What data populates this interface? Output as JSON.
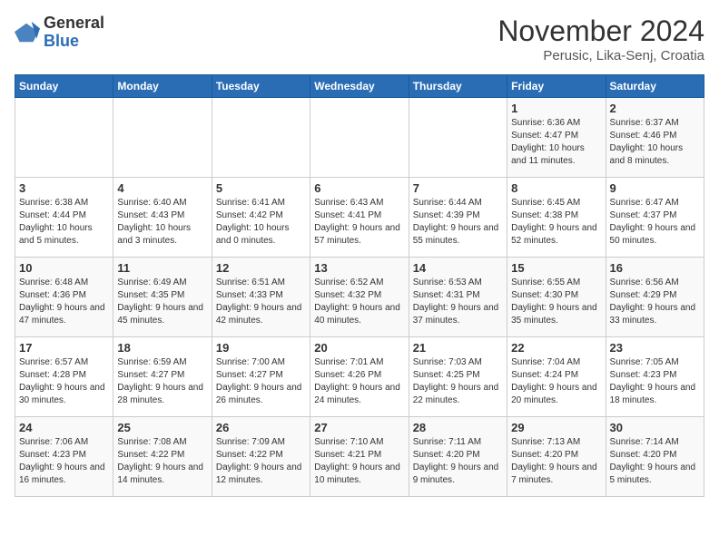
{
  "logo": {
    "general": "General",
    "blue": "Blue"
  },
  "header": {
    "month_title": "November 2024",
    "subtitle": "Perusic, Lika-Senj, Croatia"
  },
  "weekdays": [
    "Sunday",
    "Monday",
    "Tuesday",
    "Wednesday",
    "Thursday",
    "Friday",
    "Saturday"
  ],
  "weeks": [
    [
      {
        "day": "",
        "sunrise": "",
        "sunset": "",
        "daylight": ""
      },
      {
        "day": "",
        "sunrise": "",
        "sunset": "",
        "daylight": ""
      },
      {
        "day": "",
        "sunrise": "",
        "sunset": "",
        "daylight": ""
      },
      {
        "day": "",
        "sunrise": "",
        "sunset": "",
        "daylight": ""
      },
      {
        "day": "",
        "sunrise": "",
        "sunset": "",
        "daylight": ""
      },
      {
        "day": "1",
        "sunrise": "Sunrise: 6:36 AM",
        "sunset": "Sunset: 4:47 PM",
        "daylight": "Daylight: 10 hours and 11 minutes."
      },
      {
        "day": "2",
        "sunrise": "Sunrise: 6:37 AM",
        "sunset": "Sunset: 4:46 PM",
        "daylight": "Daylight: 10 hours and 8 minutes."
      }
    ],
    [
      {
        "day": "3",
        "sunrise": "Sunrise: 6:38 AM",
        "sunset": "Sunset: 4:44 PM",
        "daylight": "Daylight: 10 hours and 5 minutes."
      },
      {
        "day": "4",
        "sunrise": "Sunrise: 6:40 AM",
        "sunset": "Sunset: 4:43 PM",
        "daylight": "Daylight: 10 hours and 3 minutes."
      },
      {
        "day": "5",
        "sunrise": "Sunrise: 6:41 AM",
        "sunset": "Sunset: 4:42 PM",
        "daylight": "Daylight: 10 hours and 0 minutes."
      },
      {
        "day": "6",
        "sunrise": "Sunrise: 6:43 AM",
        "sunset": "Sunset: 4:41 PM",
        "daylight": "Daylight: 9 hours and 57 minutes."
      },
      {
        "day": "7",
        "sunrise": "Sunrise: 6:44 AM",
        "sunset": "Sunset: 4:39 PM",
        "daylight": "Daylight: 9 hours and 55 minutes."
      },
      {
        "day": "8",
        "sunrise": "Sunrise: 6:45 AM",
        "sunset": "Sunset: 4:38 PM",
        "daylight": "Daylight: 9 hours and 52 minutes."
      },
      {
        "day": "9",
        "sunrise": "Sunrise: 6:47 AM",
        "sunset": "Sunset: 4:37 PM",
        "daylight": "Daylight: 9 hours and 50 minutes."
      }
    ],
    [
      {
        "day": "10",
        "sunrise": "Sunrise: 6:48 AM",
        "sunset": "Sunset: 4:36 PM",
        "daylight": "Daylight: 9 hours and 47 minutes."
      },
      {
        "day": "11",
        "sunrise": "Sunrise: 6:49 AM",
        "sunset": "Sunset: 4:35 PM",
        "daylight": "Daylight: 9 hours and 45 minutes."
      },
      {
        "day": "12",
        "sunrise": "Sunrise: 6:51 AM",
        "sunset": "Sunset: 4:33 PM",
        "daylight": "Daylight: 9 hours and 42 minutes."
      },
      {
        "day": "13",
        "sunrise": "Sunrise: 6:52 AM",
        "sunset": "Sunset: 4:32 PM",
        "daylight": "Daylight: 9 hours and 40 minutes."
      },
      {
        "day": "14",
        "sunrise": "Sunrise: 6:53 AM",
        "sunset": "Sunset: 4:31 PM",
        "daylight": "Daylight: 9 hours and 37 minutes."
      },
      {
        "day": "15",
        "sunrise": "Sunrise: 6:55 AM",
        "sunset": "Sunset: 4:30 PM",
        "daylight": "Daylight: 9 hours and 35 minutes."
      },
      {
        "day": "16",
        "sunrise": "Sunrise: 6:56 AM",
        "sunset": "Sunset: 4:29 PM",
        "daylight": "Daylight: 9 hours and 33 minutes."
      }
    ],
    [
      {
        "day": "17",
        "sunrise": "Sunrise: 6:57 AM",
        "sunset": "Sunset: 4:28 PM",
        "daylight": "Daylight: 9 hours and 30 minutes."
      },
      {
        "day": "18",
        "sunrise": "Sunrise: 6:59 AM",
        "sunset": "Sunset: 4:27 PM",
        "daylight": "Daylight: 9 hours and 28 minutes."
      },
      {
        "day": "19",
        "sunrise": "Sunrise: 7:00 AM",
        "sunset": "Sunset: 4:27 PM",
        "daylight": "Daylight: 9 hours and 26 minutes."
      },
      {
        "day": "20",
        "sunrise": "Sunrise: 7:01 AM",
        "sunset": "Sunset: 4:26 PM",
        "daylight": "Daylight: 9 hours and 24 minutes."
      },
      {
        "day": "21",
        "sunrise": "Sunrise: 7:03 AM",
        "sunset": "Sunset: 4:25 PM",
        "daylight": "Daylight: 9 hours and 22 minutes."
      },
      {
        "day": "22",
        "sunrise": "Sunrise: 7:04 AM",
        "sunset": "Sunset: 4:24 PM",
        "daylight": "Daylight: 9 hours and 20 minutes."
      },
      {
        "day": "23",
        "sunrise": "Sunrise: 7:05 AM",
        "sunset": "Sunset: 4:23 PM",
        "daylight": "Daylight: 9 hours and 18 minutes."
      }
    ],
    [
      {
        "day": "24",
        "sunrise": "Sunrise: 7:06 AM",
        "sunset": "Sunset: 4:23 PM",
        "daylight": "Daylight: 9 hours and 16 minutes."
      },
      {
        "day": "25",
        "sunrise": "Sunrise: 7:08 AM",
        "sunset": "Sunset: 4:22 PM",
        "daylight": "Daylight: 9 hours and 14 minutes."
      },
      {
        "day": "26",
        "sunrise": "Sunrise: 7:09 AM",
        "sunset": "Sunset: 4:22 PM",
        "daylight": "Daylight: 9 hours and 12 minutes."
      },
      {
        "day": "27",
        "sunrise": "Sunrise: 7:10 AM",
        "sunset": "Sunset: 4:21 PM",
        "daylight": "Daylight: 9 hours and 10 minutes."
      },
      {
        "day": "28",
        "sunrise": "Sunrise: 7:11 AM",
        "sunset": "Sunset: 4:20 PM",
        "daylight": "Daylight: 9 hours and 9 minutes."
      },
      {
        "day": "29",
        "sunrise": "Sunrise: 7:13 AM",
        "sunset": "Sunset: 4:20 PM",
        "daylight": "Daylight: 9 hours and 7 minutes."
      },
      {
        "day": "30",
        "sunrise": "Sunrise: 7:14 AM",
        "sunset": "Sunset: 4:20 PM",
        "daylight": "Daylight: 9 hours and 5 minutes."
      }
    ]
  ]
}
